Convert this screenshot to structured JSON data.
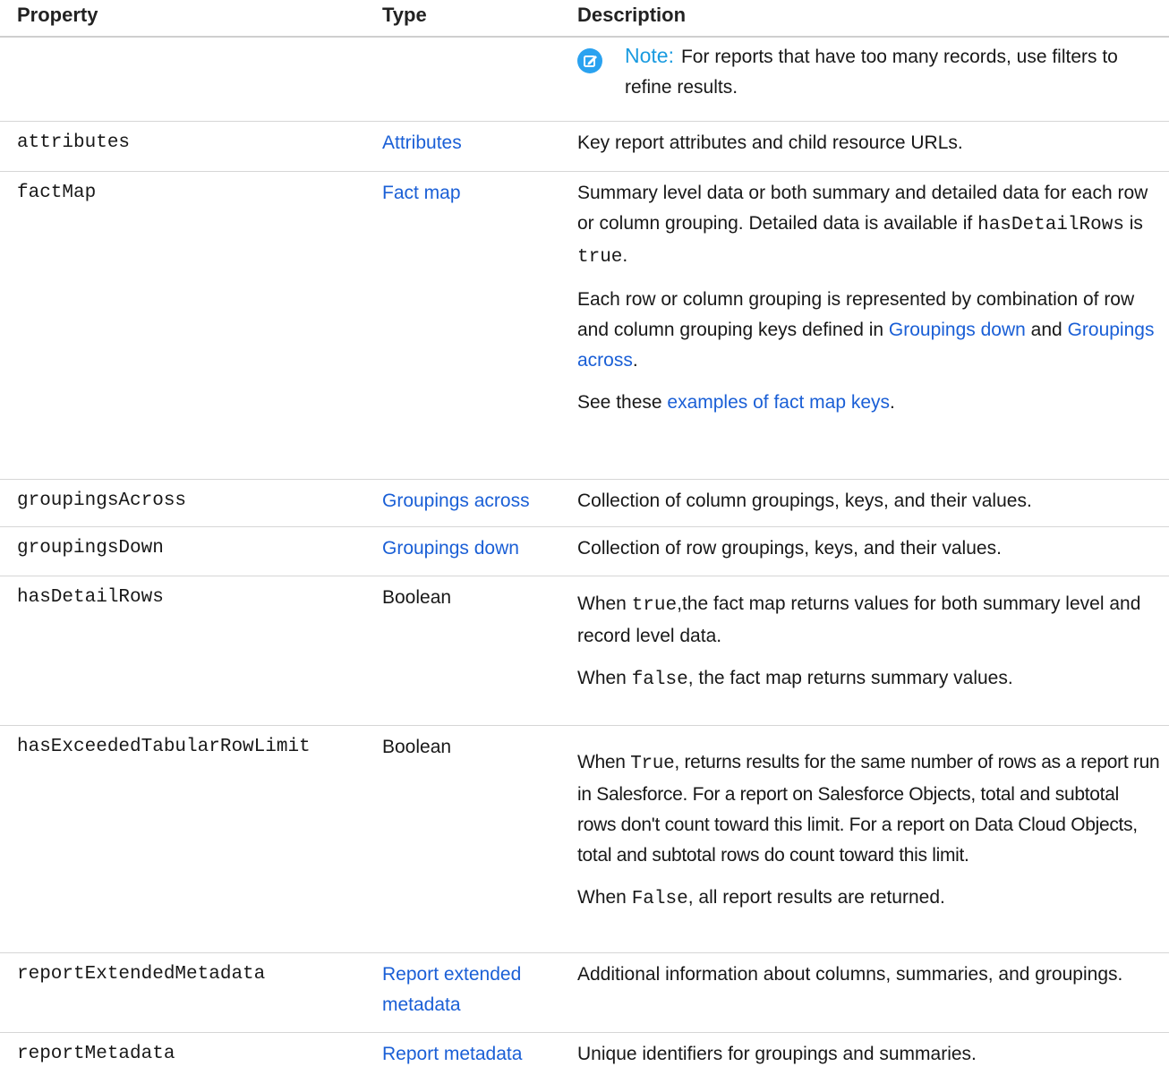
{
  "headers": {
    "property": "Property",
    "type": "Type",
    "description": "Description"
  },
  "note": {
    "label": "Note:",
    "text": "For reports that have too many records, use filters to refine results.",
    "icon": "edit-note-icon"
  },
  "rows": {
    "attributes": {
      "property": "attributes",
      "type": "Attributes",
      "description": "Key report attributes and child resource URLs."
    },
    "factMap": {
      "property": "factMap",
      "type": "Fact map",
      "p1_a": "Summary level data or both summary and detailed data for each row or column grouping. Detailed data is available if ",
      "p1_code1": "hasDetailRows",
      "p1_b": " is ",
      "p1_code2": "true",
      "p1_c": ".",
      "p2_a": "Each row or column grouping is represented by combination of row and column grouping keys defined in ",
      "p2_link1": "Groupings down",
      "p2_b": " and ",
      "p2_link2": "Groupings across",
      "p2_c": ".",
      "p3_a": "See these ",
      "p3_link": "examples of fact map keys",
      "p3_b": "."
    },
    "groupingsAcross": {
      "property": "groupingsAcross",
      "type": "Groupings across",
      "description": "Collection of column groupings, keys, and their values."
    },
    "groupingsDown": {
      "property": "groupingsDown",
      "type": "Groupings down",
      "description": "Collection of row groupings, keys, and their values."
    },
    "hasDetailRows": {
      "property": "hasDetailRows",
      "type": "Boolean",
      "p1_a": "When ",
      "p1_code": "true",
      "p1_b": ",the fact map returns values for both summary level and record level data.",
      "p2_a": "When ",
      "p2_code": "false",
      "p2_b": ", the fact map returns summary values."
    },
    "hasExceededTabularRowLimit": {
      "property": "hasExceededTabularRowLimit",
      "type": "Boolean",
      "p1_a": "When ",
      "p1_code": "True",
      "p1_b": ", returns results for the same number of rows as a report run in Salesforce. For a report on Salesforce Objects, total and subtotal rows don't count toward this limit. For a report on Data Cloud Objects, total and subtotal rows do count toward this limit.",
      "p2_a": "When ",
      "p2_code": "False",
      "p2_b": ", all report results are returned."
    },
    "reportExtendedMetadata": {
      "property": "reportExtendedMetadata",
      "type": "Report extended metadata",
      "description": "Additional information about columns, summaries, and groupings."
    },
    "reportMetadata": {
      "property": "reportMetadata",
      "type": "Report metadata",
      "description": "Unique identifiers for groupings and summaries."
    }
  }
}
